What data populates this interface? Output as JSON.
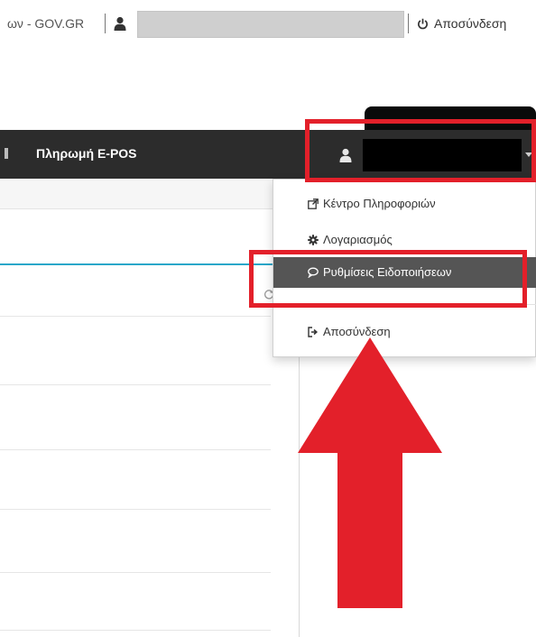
{
  "topbar": {
    "site_name": "ων - GOV.GR",
    "user_icon": "user-icon",
    "logout_label": "Αποσύνδεση",
    "logout_icon": "power-icon"
  },
  "navbar": {
    "item_label": "Πληρωμή E-POS",
    "user_icon": "user-icon",
    "caret_icon": "caret-down-icon",
    "background_color": "#2c2c2c"
  },
  "dropdown": {
    "items": [
      {
        "label": "Κέντρο Πληροφοριών",
        "icon": "external-link-icon"
      },
      {
        "label": "Λογαριασμός",
        "icon": "gear-icon"
      },
      {
        "label": "Ρυθμίσεις Ειδοποιήσεων",
        "icon": "speech-bubble-icon",
        "active": true
      },
      {
        "label": "Αποσύνδεση",
        "icon": "sign-out-icon"
      }
    ]
  },
  "annotations": {
    "highlight_color": "#e3202a",
    "arrow_color": "#e3202a"
  },
  "content": {
    "accent_color": "#2aa7c9"
  }
}
